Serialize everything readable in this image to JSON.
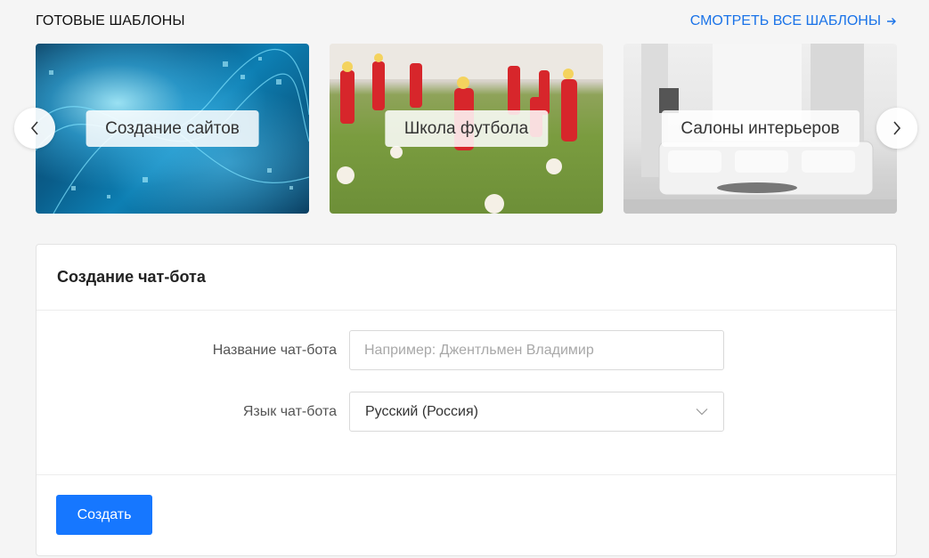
{
  "templates": {
    "title": "ГОТОВЫЕ ШАБЛОНЫ",
    "view_all": "СМОТРЕТЬ ВСЕ ШАБЛОНЫ",
    "cards": [
      {
        "label": "Создание сайтов",
        "icon": "tech-image"
      },
      {
        "label": "Школа футбола",
        "icon": "football-image"
      },
      {
        "label": "Салоны интерьеров",
        "icon": "interior-image"
      }
    ]
  },
  "carousel": {
    "prev_icon": "chevron-left-icon",
    "next_icon": "chevron-right-icon"
  },
  "chatbot_form": {
    "title": "Создание чат-бота",
    "name_label": "Название чат-бота",
    "name_value": "",
    "name_placeholder": "Например: Джентльмен Владимир",
    "lang_label": "Язык чат-бота",
    "lang_value": "Русский (Россия)",
    "submit_label": "Создать"
  },
  "colors": {
    "accent": "#1677ff",
    "link": "#1a73e8",
    "background": "#f5f5f5"
  }
}
